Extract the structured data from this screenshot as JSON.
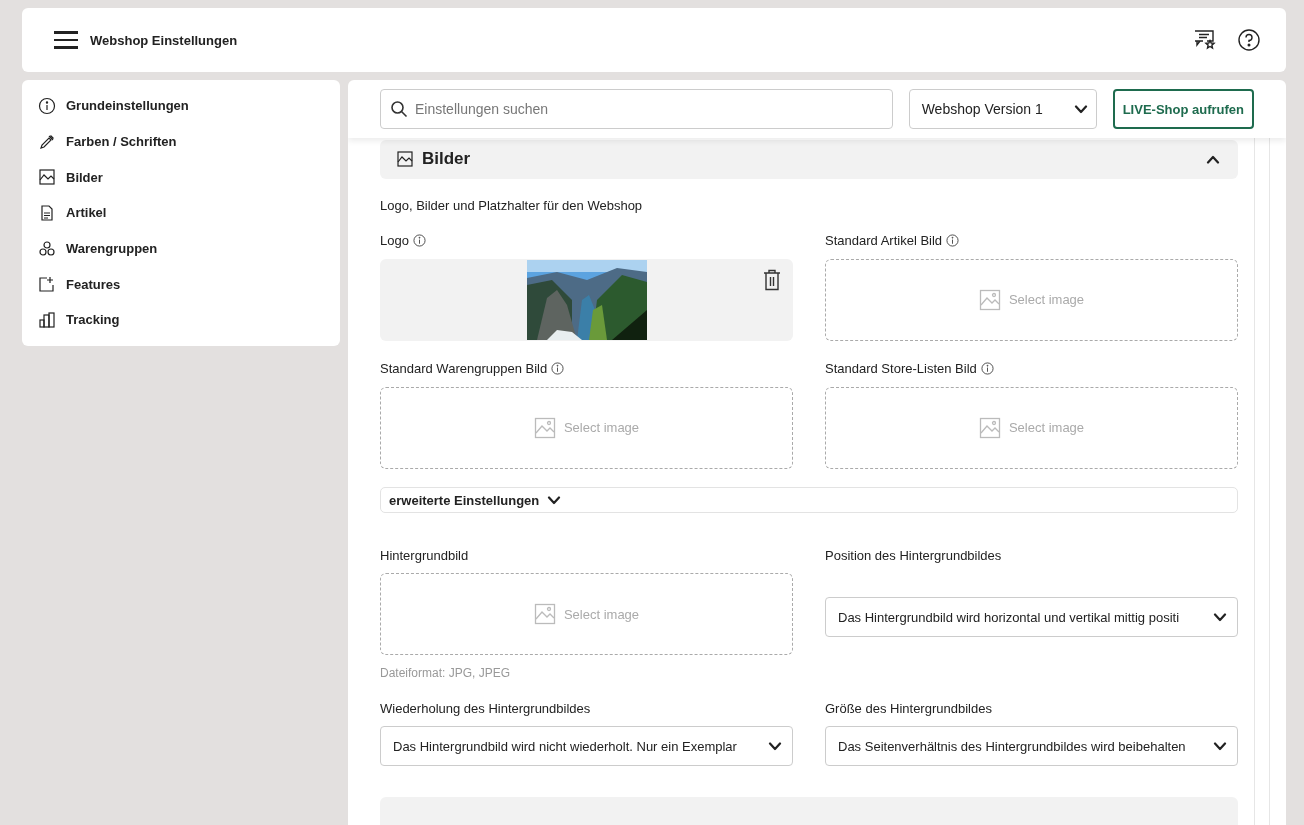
{
  "header": {
    "title": "Webshop Einstellungen"
  },
  "sidebar": {
    "items": [
      {
        "label": "Grundeinstellungen",
        "selected": false
      },
      {
        "label": "Farben / Schriften",
        "selected": false
      },
      {
        "label": "Bilder",
        "selected": false
      },
      {
        "label": "Artikel",
        "selected": false
      },
      {
        "label": "Warengruppen",
        "selected": false
      },
      {
        "label": "Features",
        "selected": false
      },
      {
        "label": "Tracking",
        "selected": false
      }
    ]
  },
  "toolbar": {
    "search": {
      "placeholder": "Einstellungen suchen"
    },
    "version_select": {
      "value": "Webshop Version 1"
    },
    "live_button": "LIVE-Shop aufrufen"
  },
  "section": {
    "title": "Bilder",
    "expanded": true,
    "description": "Logo, Bilder und Platzhalter für den Webshop",
    "image_fields": [
      {
        "label": "Logo",
        "info": true,
        "kind": "picture"
      },
      {
        "label": "Standard Artikel Bild",
        "info": true,
        "kind": "empty",
        "placeholder": "Select image"
      },
      {
        "label": "Standard Warengruppen Bild",
        "info": true,
        "kind": "empty",
        "placeholder": "Select image"
      },
      {
        "label": "Standard Store-Listen Bild",
        "info": true,
        "kind": "empty",
        "placeholder": "Select image"
      }
    ],
    "advanced": {
      "label": "erweiterte Einstellungen",
      "expanded": false
    },
    "background_image": {
      "label": "Hintergrundbild",
      "placeholder": "Select image",
      "hint": "Dateiformat: JPG, JPEG"
    },
    "position_select": {
      "label": "Position des Hintergrundbildes",
      "value": "Das Hintergrundbild wird horizontal und vertikal mittig positi"
    },
    "repeat_select": {
      "label": "Wiederholung des Hintergrundbildes",
      "value": "Das Hintergrundbild wird nicht wiederholt. Nur ein Exemplar"
    },
    "size_select": {
      "label": "Größe des Hintergrundbildes",
      "value": "Das Seitenverhältnis des Hintergrundbildes wird beibehalten"
    }
  }
}
